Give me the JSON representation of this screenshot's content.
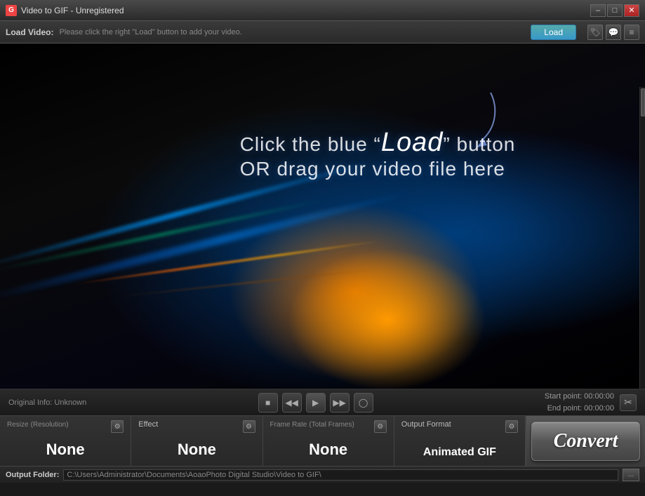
{
  "window": {
    "title": "Video to GIF - Unregistered",
    "icon": "G"
  },
  "titlebar": {
    "minimize_label": "–",
    "maximize_label": "□",
    "close_label": "✕"
  },
  "load_bar": {
    "label": "Load Video:",
    "placeholder": "Please click the right \"Load\" button to add your video.",
    "load_button": "Load"
  },
  "toolbar": {
    "tag_icon": "🏷",
    "chat_icon": "💬",
    "list_icon": "≡"
  },
  "video_area": {
    "instruction_line1": "Click the blue “Load” button",
    "instruction_line2": "OR drag your video file here",
    "load_word": "Load"
  },
  "controls": {
    "original_info": "Original Info: Unknown",
    "start_point": "Start point: 00:00:00",
    "end_point": "End point: 00:00:00"
  },
  "sections": {
    "resize": {
      "title": "Resize",
      "subtitle": "(Resolution)",
      "value": "None"
    },
    "effect": {
      "title": "Effect",
      "subtitle": "",
      "value": "None"
    },
    "framerate": {
      "title": "Frame Rate",
      "subtitle": "(Total Frames)",
      "value": "None"
    },
    "output_format": {
      "title": "Output Format",
      "subtitle": "",
      "value": "Animated GIF"
    }
  },
  "convert": {
    "label": "Convert"
  },
  "output_folder": {
    "label": "Output Folder:",
    "path": "C:\\Users\\Administrator\\Documents\\AoaoPhoto Digital Studio\\Video to GIF\\",
    "browse_label": "..."
  }
}
